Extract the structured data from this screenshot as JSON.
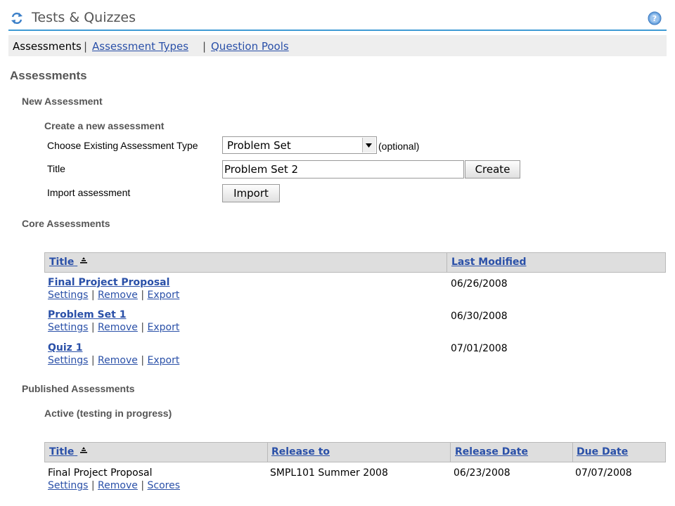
{
  "header": {
    "title": "Tests & Quizzes",
    "refresh_icon": "refresh-icon",
    "help_icon": "help-icon"
  },
  "nav": {
    "current": "Assessments",
    "sep1": "|",
    "link1": "Assessment Types",
    "sep2": "|",
    "link2": "Question Pools"
  },
  "page_title": "Assessments",
  "new_assessment": {
    "heading": "New Assessment",
    "subheading": "Create a new assessment",
    "type_label": "Choose Existing Assessment Type",
    "type_value": "Problem Set",
    "optional": "(optional)",
    "title_label": "Title",
    "title_value": "Problem Set 2",
    "create_button": "Create",
    "import_label": "Import assessment",
    "import_button": "Import"
  },
  "core": {
    "heading": "Core Assessments",
    "headers": {
      "title": "Title",
      "modified": "Last Modified"
    },
    "rows": [
      {
        "title": "Final Project Proposal",
        "date": "06/26/2008"
      },
      {
        "title": "Problem Set 1",
        "date": "06/30/2008"
      },
      {
        "title": "Quiz 1",
        "date": "07/01/2008"
      }
    ],
    "actions": [
      "Settings",
      "Remove",
      "Export"
    ],
    "sep": "|"
  },
  "published": {
    "heading": "Published Assessments",
    "subheading": "Active (testing in progress)",
    "headers": {
      "title": "Title",
      "release_to": "Release to",
      "release_date": "Release Date",
      "due_date": "Due Date"
    },
    "rows": [
      {
        "title": "Final Project Proposal",
        "release_to": "SMPL101 Summer 2008",
        "release_date": "06/23/2008",
        "due_date": "07/07/2008"
      }
    ],
    "actions": [
      "Settings",
      "Remove",
      "Scores"
    ],
    "sep": "|"
  }
}
